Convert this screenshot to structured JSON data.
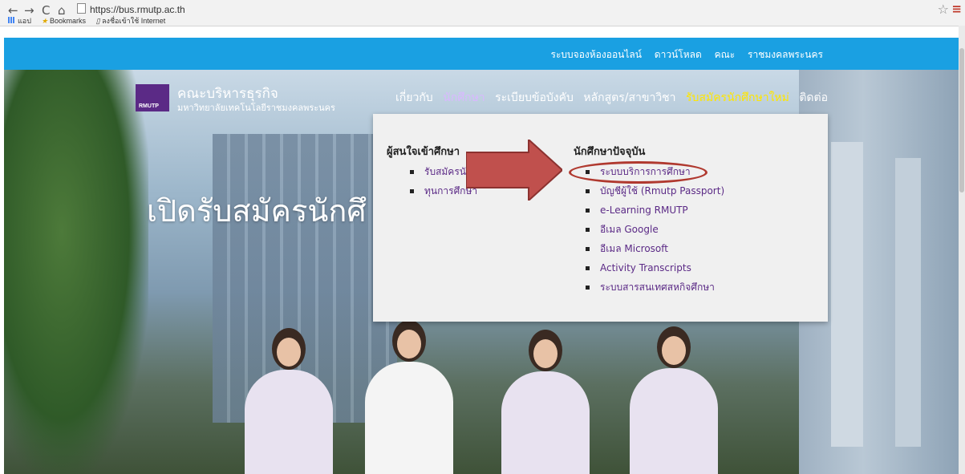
{
  "browser": {
    "url": "https://bus.rmutp.ac.th",
    "bookmarks": [
      "แอป",
      "Bookmarks",
      "ลงชื่อเข้าใช้ Internet"
    ],
    "icons": [
      "back-icon",
      "forward-icon",
      "reload-icon",
      "home-icon",
      "star-icon",
      "menu-icon"
    ]
  },
  "site": {
    "top_links": [
      "ระบบจองห้องออนไลน์",
      "ดาวน์โหลด",
      "คณะ",
      "ราชมงคลพระนคร"
    ],
    "logo": {
      "mark": "RMUTP",
      "title": "คณะบริหารธุรกิจ",
      "subtitle": "มหาวิทยาลัยเทคโนโลยีราชมงคลพระนคร"
    },
    "nav": [
      "เกี่ยวกับ",
      "นักศึกษา",
      "ระเบียบข้อบังคับ",
      "หลักสูตร/สาขาวิชา",
      "รับสมัครนักศึกษาใหม่",
      "ติดต่อ"
    ],
    "hero_title": "เปิดรับสมัครนักศึ",
    "dropdown": {
      "col1": {
        "heading": "ผู้สนใจเข้าศึกษา",
        "items": [
          "รับสมัครนักศึ",
          "ทุนการศึกษา"
        ]
      },
      "col2": {
        "heading": "นักศึกษาปัจจุบัน",
        "items": [
          "ระบบบริการการศึกษา",
          "บัญชีผู้ใช้ (Rmutp Passport)",
          "e-Learning RMUTP",
          "อีเมล Google",
          "อีเมล Microsoft",
          "Activity Transcripts",
          "ระบบสารสนเทศสหกิจศึกษา"
        ]
      }
    }
  },
  "colors": {
    "topbar": "#1aa0e2",
    "accent_purple": "#5b2a86",
    "nav_highlight": "#ffe600",
    "arrow_red": "#c0504d"
  }
}
